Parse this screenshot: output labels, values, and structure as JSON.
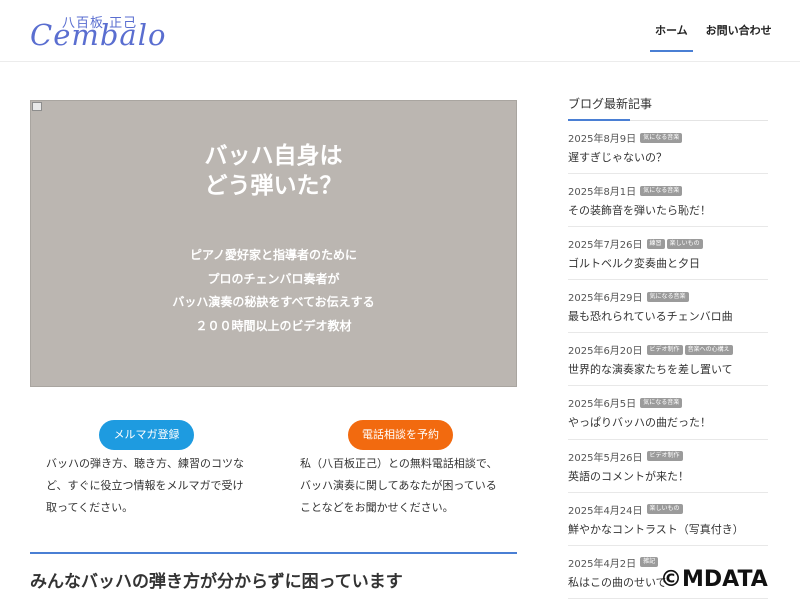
{
  "header": {
    "logo_kanji": "八百板 正己",
    "logo_script": "Cembalo",
    "nav": [
      {
        "label": "ホーム"
      },
      {
        "label": "お問い合わせ"
      }
    ]
  },
  "hero": {
    "title_line1": "バッハ自身は",
    "title_line2": "どう弾いた？",
    "lines": [
      "ピアノ愛好家と指導者のために",
      "プロのチェンバロ奏者が",
      "バッハ演奏の秘訣をすべてお伝えする",
      "２００時間以上のビデオ教材"
    ]
  },
  "cta": {
    "mail_label": "メルマガ登録",
    "mail_desc": "バッハの弾き方、聴き方、練習のコツなど、すぐに役立つ情報をメルマガで受け取ってください。",
    "phone_label": "電話相談を予約",
    "phone_desc": "私（八百板正己）との無料電話相談で、バッハ演奏に関してあなたが困っていることなどをお聞かせください。"
  },
  "section": {
    "heading": "みんなバッハの弾き方が分からずに困っています"
  },
  "sidebar": {
    "title": "ブログ最新記事",
    "posts": [
      {
        "date": "2025年8月9日",
        "tags": [
          "気になる音楽"
        ],
        "title": "遅すぎじゃないの？"
      },
      {
        "date": "2025年8月1日",
        "tags": [
          "気になる音楽"
        ],
        "title": "その装飾音を弾いたら恥だ！"
      },
      {
        "date": "2025年7月26日",
        "tags": [
          "練習",
          "楽しいもの"
        ],
        "title": "ゴルトベルク変奏曲と夕日"
      },
      {
        "date": "2025年6月29日",
        "tags": [
          "気になる音楽"
        ],
        "title": "最も恐れられているチェンバロ曲"
      },
      {
        "date": "2025年6月20日",
        "tags": [
          "ビデオ制作",
          "音楽への心構え"
        ],
        "title": "世界的な演奏家たちを差し置いて"
      },
      {
        "date": "2025年6月5日",
        "tags": [
          "気になる音楽"
        ],
        "title": "やっぱりバッハの曲だった！"
      },
      {
        "date": "2025年5月26日",
        "tags": [
          "ビデオ制作"
        ],
        "title": "英語のコメントが来た！"
      },
      {
        "date": "2025年4月24日",
        "tags": [
          "楽しいもの"
        ],
        "title": "鮮やかなコントラスト（写真付き）"
      },
      {
        "date": "2025年4月2日",
        "tags": [
          "雑記"
        ],
        "title": "私はこの曲のせいで"
      }
    ]
  },
  "watermark": "©MDATA",
  "colors": {
    "accent": "#4a7fd4",
    "mail_button": "#1e9be0",
    "phone_button": "#f26a0f",
    "hero_bg": "#bbb6b1",
    "tag_bg": "#9b9b9b"
  }
}
